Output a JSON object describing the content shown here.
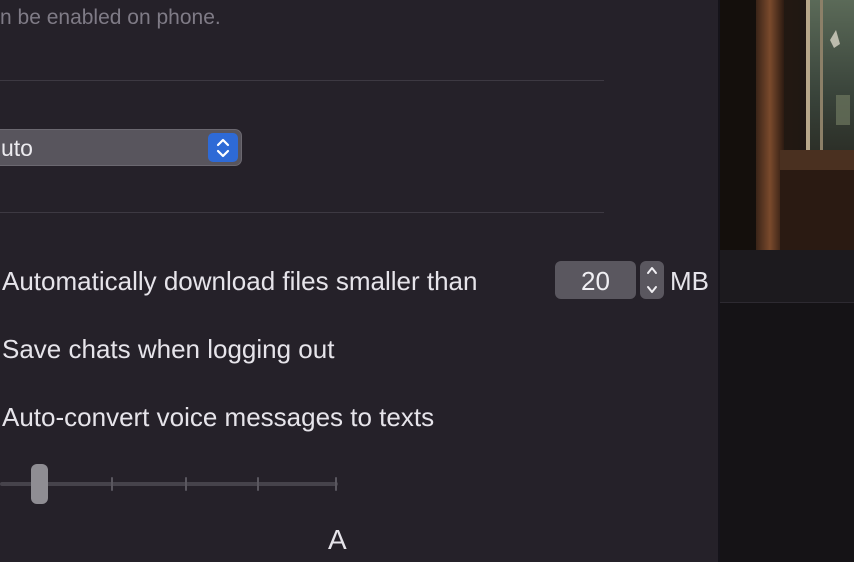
{
  "privacy": {
    "hint_text": "n be enabled on phone."
  },
  "theme_select": {
    "value": "uto"
  },
  "downloads": {
    "auto_download_label": "Automatically download files smaller than",
    "size_value": "20",
    "size_unit": "MB"
  },
  "options": {
    "save_chats_label": "Save chats when logging out",
    "auto_convert_label": "Auto-convert voice messages to texts"
  },
  "font_size_slider": {
    "large_label": "A",
    "position_fraction": 0.0
  },
  "colors": {
    "panel_bg": "#252129",
    "accent": "#2e6ad6",
    "text": "#e6e4ea",
    "muted_text": "#7f7b86"
  }
}
